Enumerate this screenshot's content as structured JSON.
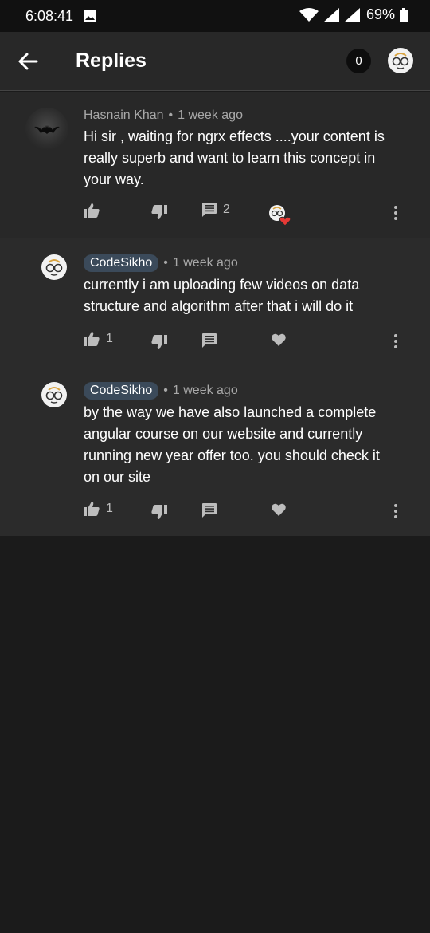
{
  "status": {
    "time": "6:08:41",
    "battery": "69%"
  },
  "header": {
    "title": "Replies",
    "count": "0"
  },
  "comment": {
    "author": "Hasnain Khan",
    "time": "1 week ago",
    "text": "Hi sir , waiting for ngrx effects ....your content is really superb and want to learn this concept in your way.",
    "reply_count": "2"
  },
  "replies": [
    {
      "author": "CodeSikho",
      "time": "1 week ago",
      "text": "currently i am uploading few videos on data structure and algorithm after that i will do it",
      "likes": "1"
    },
    {
      "author": "CodeSikho",
      "time": "1 week ago",
      "text": "by the way we have also launched a complete angular course on our website and currently running new year offer too. you should check it on our site",
      "likes": "1"
    }
  ],
  "meta": {
    "separator": "•"
  },
  "colors": {
    "background": "#1b1b1b",
    "card": "#282828",
    "heart": "#e53935",
    "chip": "#3b4a5a"
  }
}
